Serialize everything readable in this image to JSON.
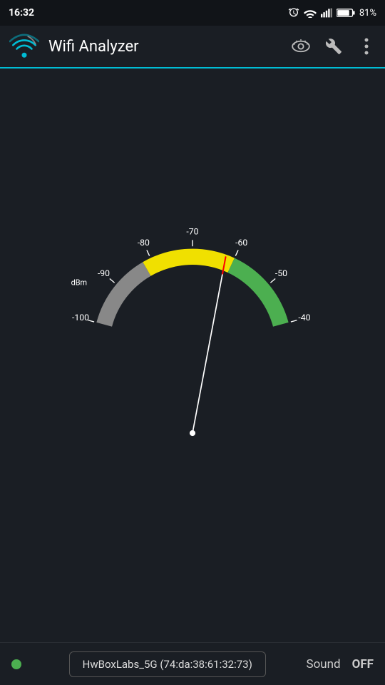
{
  "statusBar": {
    "time": "16:32",
    "battery": "81%",
    "icons": [
      "alarm",
      "wifi",
      "signal",
      "battery"
    ]
  },
  "toolbar": {
    "title": "Wifi Analyzer",
    "actions": [
      "eye-icon",
      "wrench-icon",
      "more-icon"
    ]
  },
  "gauge": {
    "labels": [
      "-100",
      "-90",
      "-80",
      "-70",
      "-60",
      "-50",
      "-40"
    ],
    "dbm_label": "dBm",
    "needle_value": -62,
    "arc_min": -100,
    "arc_max": -40
  },
  "bottomBar": {
    "network_name": "HwBoxLabs_5G (74:da:38:61:32:73)",
    "sound_label": "Sound",
    "off_label": "OFF",
    "green_dot": true
  }
}
